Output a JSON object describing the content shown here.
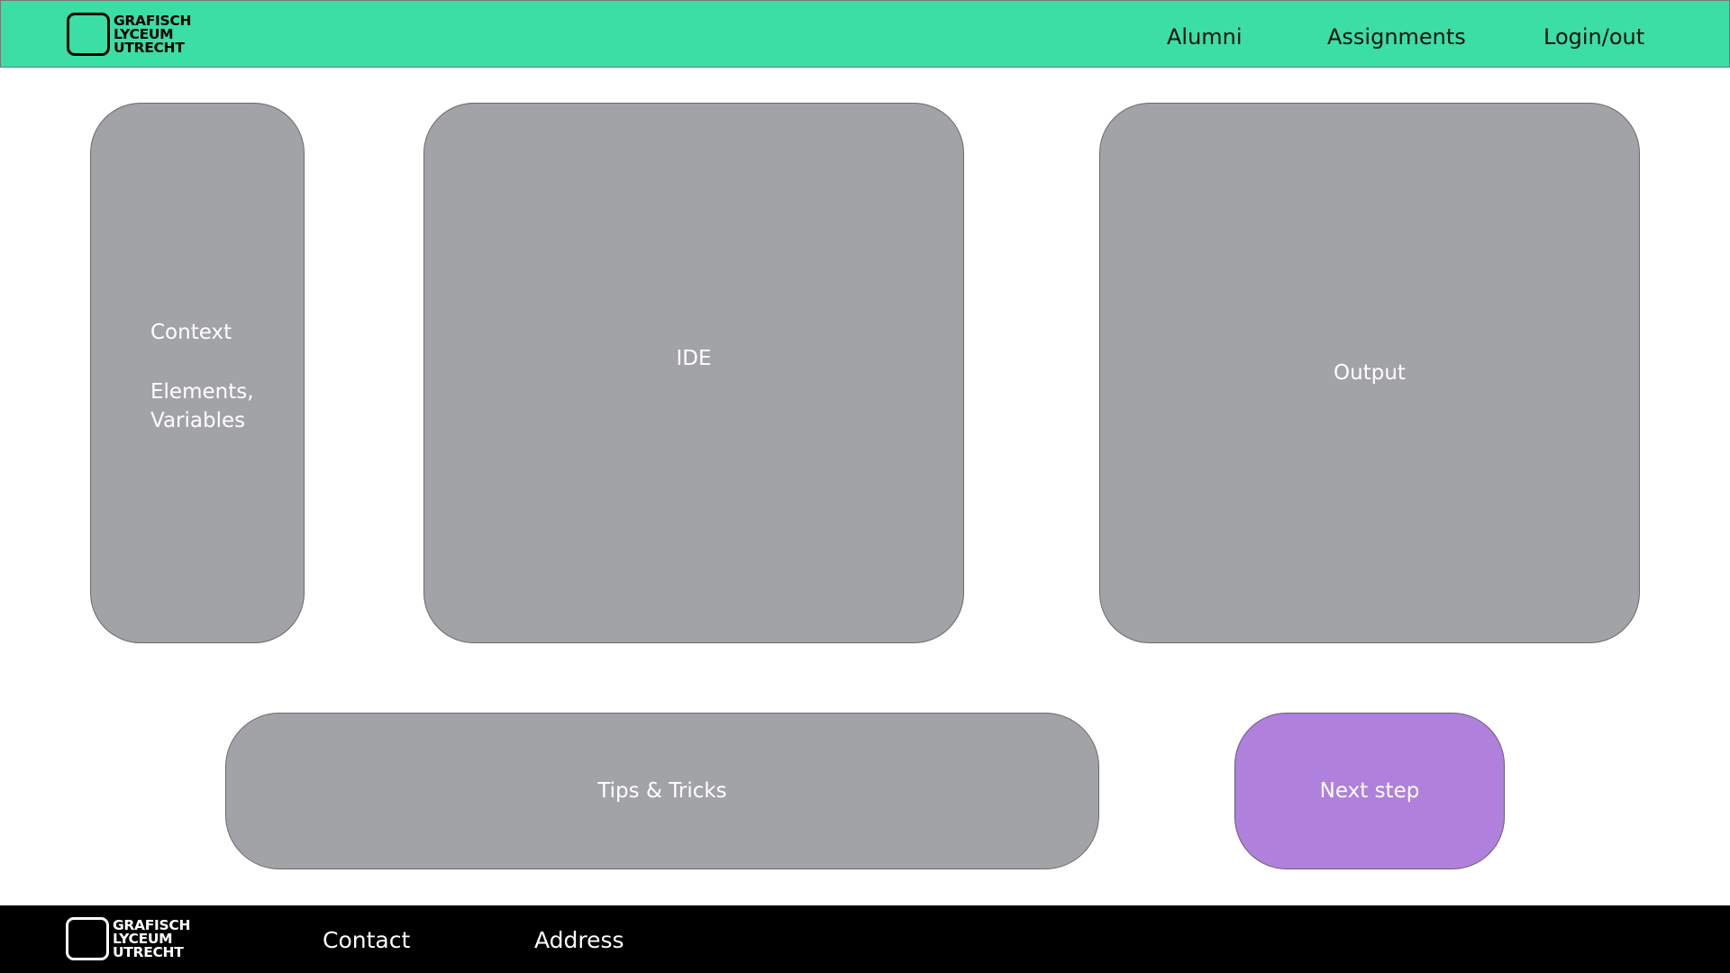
{
  "header": {
    "logo_lines": [
      "GRAFISCH",
      "LYCEUM",
      "UTRECHT"
    ],
    "nav": [
      "Alumni",
      "Assignments",
      "Login/out"
    ],
    "background_color": "#3bdea5"
  },
  "main": {
    "context": {
      "title": "Context",
      "line1": "Elements,",
      "line2": "Variables"
    },
    "ide": "IDE",
    "output": "Output",
    "tips": "Tips & Tricks",
    "next_step": "Next step",
    "panel_color": "#a2a3a6",
    "next_color": "#b081dc"
  },
  "footer": {
    "logo_lines": [
      "GRAFISCH",
      "LYCEUM",
      "UTRECHT"
    ],
    "links": [
      "Contact",
      "Address"
    ],
    "background_color": "#000000"
  }
}
